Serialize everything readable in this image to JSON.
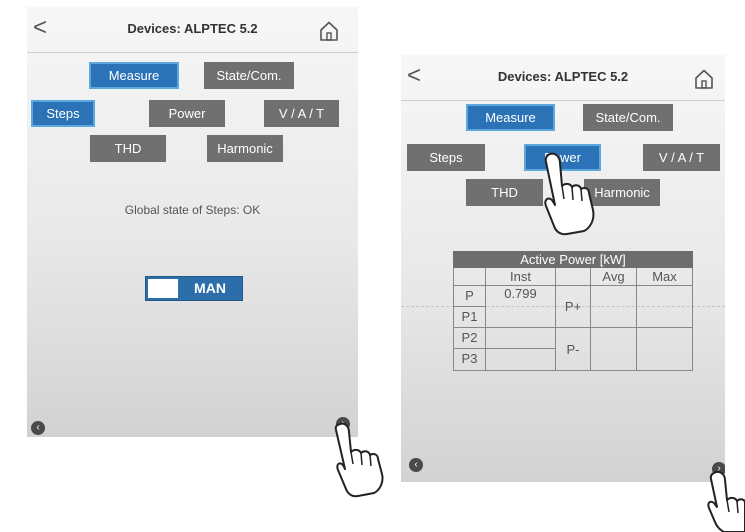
{
  "screen1": {
    "title": "Devices: ALPTEC 5.2",
    "back_glyph": "<",
    "tabs": {
      "measure": "Measure",
      "state": "State/Com."
    },
    "subtabs": {
      "steps": "Steps",
      "power": "Power",
      "vat": "V / A / T",
      "thd": "THD",
      "harmonic": "Harmonic"
    },
    "status_text": "Global state of Steps: OK",
    "mode_toggle": {
      "label": "MAN"
    },
    "nav_prev": "‹",
    "nav_next": "›",
    "home_icon": "home-icon"
  },
  "screen2": {
    "title": "Devices: ALPTEC 5.2",
    "back_glyph": "<",
    "tabs": {
      "measure": "Measure",
      "state": "State/Com."
    },
    "subtabs": {
      "steps": "Steps",
      "power": "Power",
      "vat": "V / A / T",
      "thd": "THD",
      "harmonic": "Harmonic"
    },
    "table": {
      "title": "Active Power [kW]",
      "col_inst": "Inst",
      "col_avg": "Avg",
      "col_max": "Max",
      "rows": [
        "P",
        "P1",
        "P2",
        "P3"
      ],
      "p_inst": "0.799",
      "p_plus": "P+",
      "p_minus": "P-"
    },
    "nav_prev": "‹",
    "nav_next": "›"
  },
  "colors": {
    "selected": "#2b72b6",
    "unselected": "#707070",
    "toggle": "#2c6ea9"
  }
}
